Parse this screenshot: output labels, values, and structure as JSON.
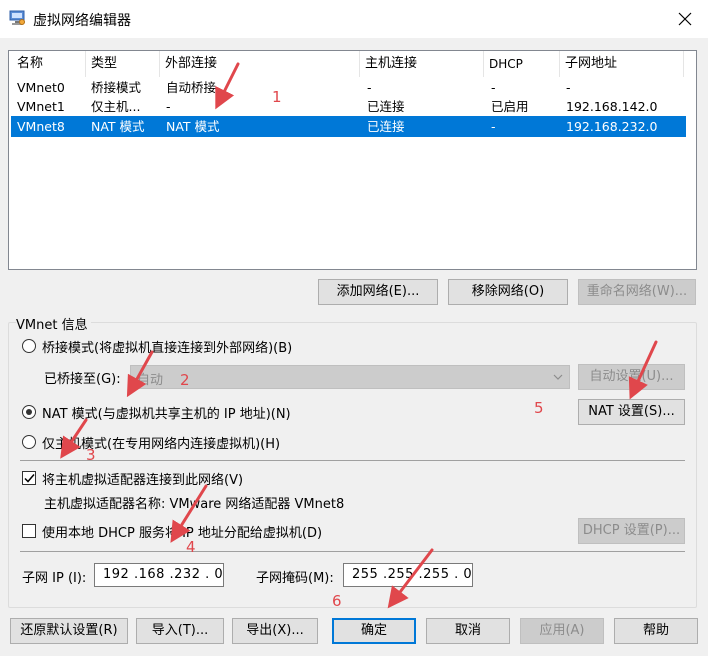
{
  "window": {
    "title": "虚拟网络编辑器"
  },
  "table": {
    "columns": [
      "名称",
      "类型",
      "外部连接",
      "主机连接",
      "DHCP",
      "子网地址"
    ],
    "rows": [
      [
        "VMnet0",
        "桥接模式",
        "自动桥接",
        "-",
        "-",
        "-"
      ],
      [
        "VMnet1",
        "仅主机...",
        "-",
        "已连接",
        "已启用",
        "192.168.142.0"
      ],
      [
        "VMnet8",
        "NAT 模式",
        "NAT 模式",
        "已连接",
        "-",
        "192.168.232.0"
      ]
    ],
    "selected_row": 2
  },
  "table_buttons": {
    "add": "添加网络(E)...",
    "remove": "移除网络(O)",
    "rename": "重命名网络(W)..."
  },
  "vmnet_info": {
    "group_label": "VMnet 信息",
    "bridge_mode": "桥接模式(将虚拟机直接连接到外部网络)(B)",
    "bridged_to_label": "已桥接至(G):",
    "bridged_to_value": "自动",
    "auto_settings": "自动设置(U)...",
    "nat_mode": "NAT 模式(与虚拟机共享主机的 IP 地址)(N)",
    "nat_settings": "NAT 设置(S)...",
    "host_only_mode": "仅主机模式(在专用网络内连接虚拟机)(H)",
    "connect_adapter": "将主机虚拟适配器连接到此网络(V)",
    "adapter_name": "主机虚拟适配器名称: VMware 网络适配器 VMnet8",
    "use_dhcp": "使用本地 DHCP 服务将 IP 地址分配给虚拟机(D)",
    "dhcp_settings": "DHCP 设置(P)...",
    "subnet_ip_label": "子网 IP (I):",
    "subnet_ip": "192 .168 .232 .  0",
    "subnet_mask_label": "子网掩码(M):",
    "subnet_mask": "255 .255 .255 .  0",
    "selected_mode": "nat",
    "connect_adapter_checked": true,
    "use_dhcp_checked": false
  },
  "footer_buttons": {
    "restore": "还原默认设置(R)",
    "import": "导入(T)...",
    "export": "导出(X)...",
    "ok": "确定",
    "cancel": "取消",
    "apply": "应用(A)",
    "help": "帮助"
  },
  "annotations": [
    "1",
    "2",
    "3",
    "4",
    "5",
    "6"
  ],
  "colors": {
    "selection": "#0078d7",
    "annotation": "#e0474c"
  }
}
